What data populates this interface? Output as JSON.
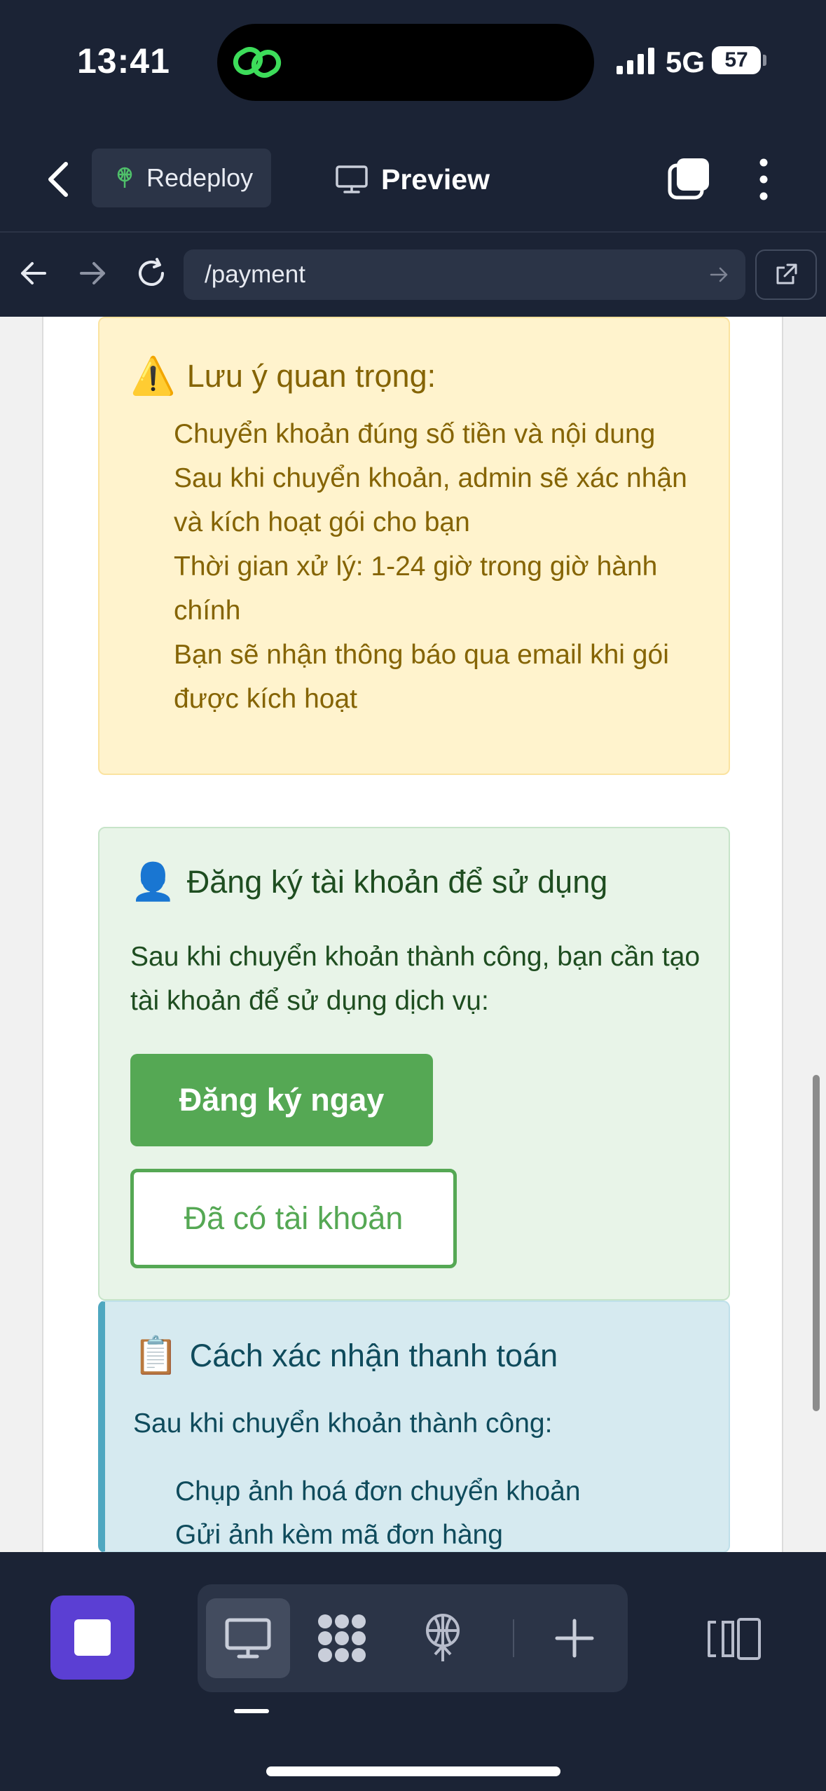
{
  "status_bar": {
    "time": "13:41",
    "network": "5G",
    "battery": "57"
  },
  "toolbar": {
    "redeploy_label": "Redeploy",
    "preview_label": "Preview"
  },
  "url_bar": {
    "url": "/payment"
  },
  "warning_box": {
    "emoji": "⚠️",
    "title": "Lưu ý quan trọng:",
    "items": [
      "Chuyển khoản đúng số tiền và nội dung",
      "Sau khi chuyển khoản, admin sẽ xác nhận và kích hoạt gói cho bạn",
      "Thời gian xử lý: 1-24 giờ trong giờ hành chính",
      "Bạn sẽ nhận thông báo qua email khi gói được kích hoạt"
    ]
  },
  "register_box": {
    "emoji": "👤",
    "title": "Đăng ký tài khoản để sử dụng",
    "description": "Sau khi chuyển khoản thành công, bạn cần tạo tài khoản để sử dụng dịch vụ:",
    "register_button": "Đăng ký ngay",
    "login_button": "Đã có tài khoản"
  },
  "confirm_box": {
    "emoji": "📋",
    "title": "Cách xác nhận thanh toán",
    "description": "Sau khi chuyển khoản thành công:",
    "items": [
      "Chụp ảnh hoá đơn chuyển khoản",
      "Gửi ảnh kèm mã đơn hàng"
    ]
  },
  "colors": {
    "app_chrome": "#1b2335",
    "warning_bg": "#fff3cd",
    "success_bg": "#e8f4e8",
    "success_accent": "#55a854",
    "info_bg": "#d6eaf0",
    "info_accent": "#4fa7c0",
    "stop_button": "#5b3fd3"
  },
  "icons": {
    "island": "link-icon",
    "redeploy": "antenna-icon",
    "preview": "monitor-icon",
    "dock": [
      "monitor-icon",
      "grid-icon",
      "antenna-icon",
      "plus-icon"
    ]
  }
}
